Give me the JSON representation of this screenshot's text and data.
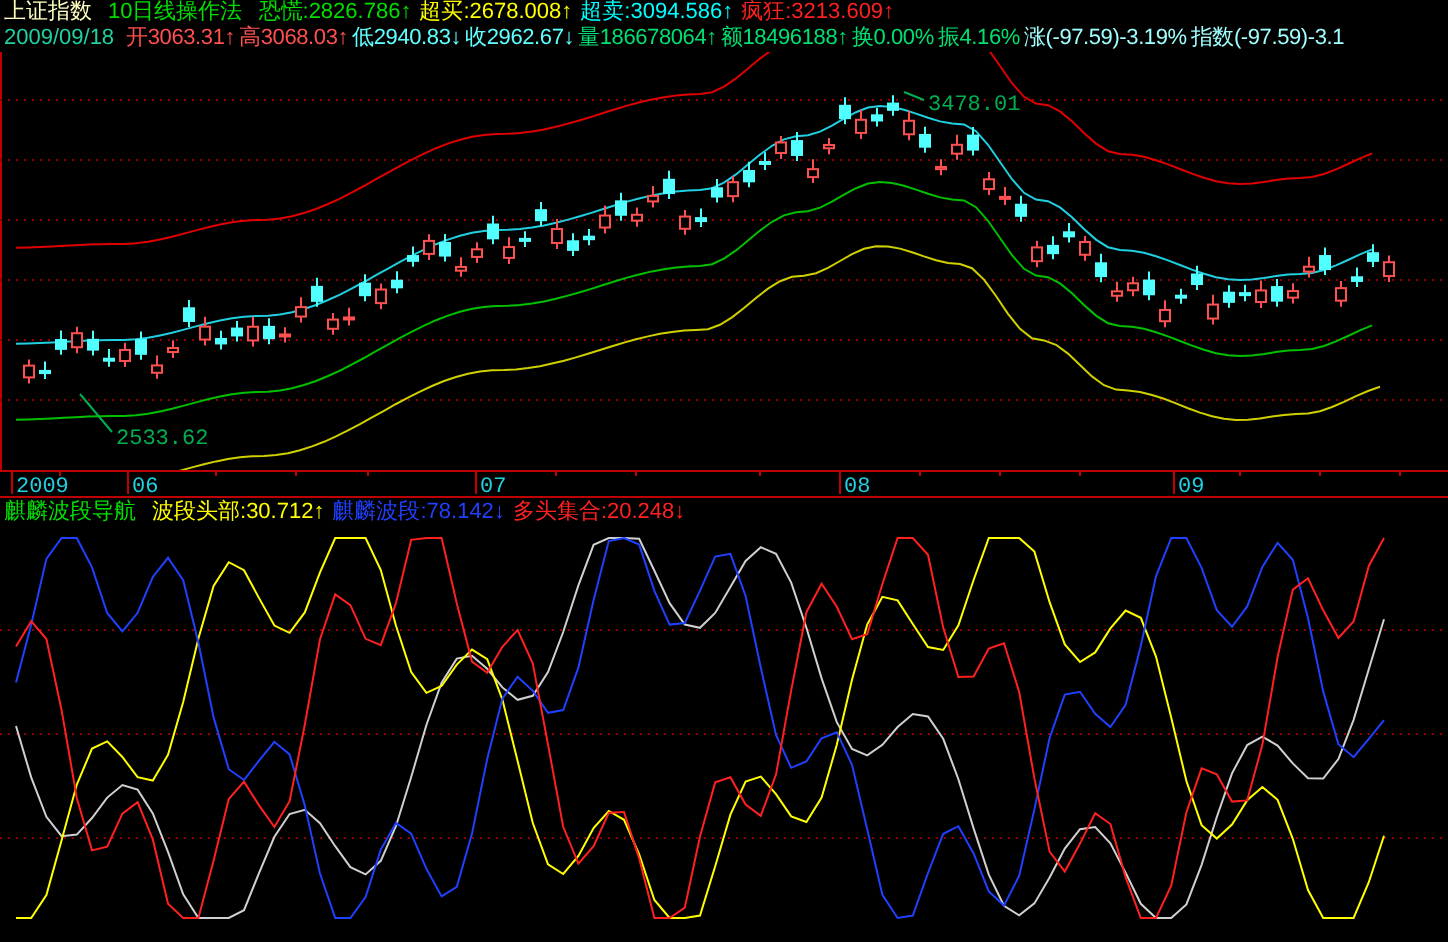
{
  "header": {
    "title": "上证指数",
    "method": "10日线操作法",
    "signals": [
      {
        "label": "恐慌:",
        "value": "2826.786",
        "arrow": "↑",
        "color": "#00e000"
      },
      {
        "label": "超买:",
        "value": "2678.008",
        "arrow": "↑",
        "color": "#ffff00"
      },
      {
        "label": "超卖:",
        "value": "3094.586",
        "arrow": "↑",
        "color": "#00ffff"
      },
      {
        "label": "疯狂:",
        "value": "3213.609",
        "arrow": "↑",
        "color": "#ff2020"
      }
    ]
  },
  "quote": {
    "date": "2009/09/18",
    "fields": [
      {
        "label": "开",
        "value": "3063.31",
        "arrow": "↑",
        "color": "#ff5050"
      },
      {
        "label": "高",
        "value": "3068.03",
        "arrow": "↑",
        "color": "#ff5050"
      },
      {
        "label": "低",
        "value": "2940.83",
        "arrow": "↓",
        "color": "#60ffff"
      },
      {
        "label": "收",
        "value": "2962.67",
        "arrow": "↓",
        "color": "#60ffff"
      },
      {
        "label": "量",
        "value": "186678064",
        "arrow": "↑",
        "color": "#00e070"
      },
      {
        "label": "额",
        "value": "18496188",
        "arrow": "↑",
        "color": "#00e070"
      },
      {
        "label": "换",
        "value": "0.00%",
        "color": "#00e070"
      },
      {
        "label": "振",
        "value": "4.16%",
        "color": "#00e070"
      },
      {
        "label": "涨",
        "value": "(-97.59)-3.19%",
        "color": "#a0ffff"
      },
      {
        "label": "指数",
        "value": "(-97.59)-3.1",
        "color": "#a0ffff"
      }
    ]
  },
  "main_chart": {
    "high_label": "3478.01",
    "low_label": "2533.62"
  },
  "x_axis": {
    "labels": [
      "2009",
      "06",
      "07",
      "08",
      "09"
    ]
  },
  "indicator": {
    "title": "麒麟波段导航",
    "lines": [
      {
        "label": "波段头部:",
        "value": "30.712",
        "arrow": "↑",
        "color": "#ffff00"
      },
      {
        "label": "麒麟波段:",
        "value": "78.142",
        "arrow": "↓",
        "color": "#2040ff"
      },
      {
        "label": "多头集合:",
        "value": "20.248",
        "arrow": "↓",
        "color": "#ff2020"
      }
    ]
  }
}
